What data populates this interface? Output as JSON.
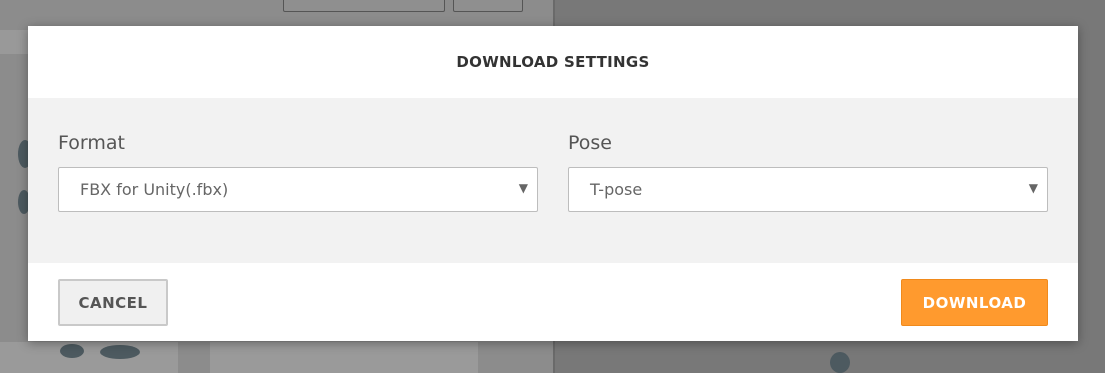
{
  "dialog": {
    "title": "DOWNLOAD SETTINGS",
    "format": {
      "label": "Format",
      "selected": "FBX for Unity(.fbx)",
      "arrow_icon": "triangle-down-icon"
    },
    "pose": {
      "label": "Pose",
      "selected": "T-pose",
      "arrow_icon": "triangle-down-icon"
    },
    "cancel_label": "CANCEL",
    "download_label": "DOWNLOAD"
  },
  "colors": {
    "accent": "#ff9a2e",
    "body_bg": "#f2f2f2",
    "overlay": "#7a7a7a"
  }
}
